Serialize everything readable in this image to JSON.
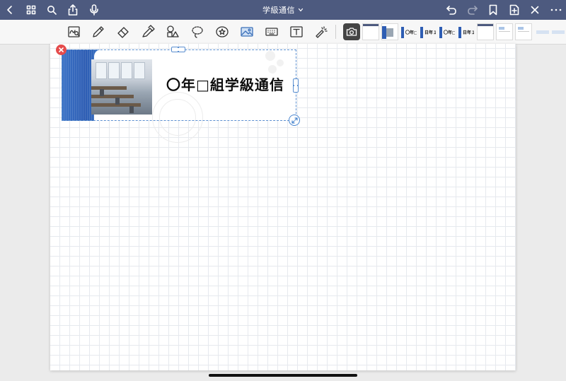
{
  "app": {
    "document_title": "学級通信"
  },
  "topbar": {
    "left_icons": [
      "back-icon",
      "grid-icon",
      "search-icon",
      "share-icon",
      "microphone-icon"
    ],
    "right_icons": [
      "undo-icon",
      "redo-icon",
      "bookmark-icon",
      "add-page-icon",
      "close-icon",
      "more-icon"
    ]
  },
  "toolbar": {
    "tools": [
      "handwriting-search-icon",
      "pen-icon",
      "eraser-icon",
      "highlighter-icon",
      "shapes-icon",
      "lasso-icon",
      "sticker-icon",
      "image-icon",
      "keyboard-icon",
      "text-icon",
      "laser-pointer-icon"
    ],
    "camera": "camera-icon",
    "thumbnails": [
      {
        "label": ""
      },
      {
        "label": ""
      },
      {
        "label": "〇年□"
      },
      {
        "label": "日年１"
      },
      {
        "label": "〇年□"
      },
      {
        "label": "日年１"
      },
      {
        "label": ""
      },
      {
        "label": ""
      },
      {
        "label": ""
      },
      {
        "label": ""
      }
    ]
  },
  "page": {
    "banner": {
      "title": "〇年□組学級通信"
    }
  },
  "colors": {
    "topbar": "#4d5a7f",
    "selection": "#5b8fd0",
    "delete": "#e54b4b",
    "banner_blue": "#2e5db3"
  }
}
